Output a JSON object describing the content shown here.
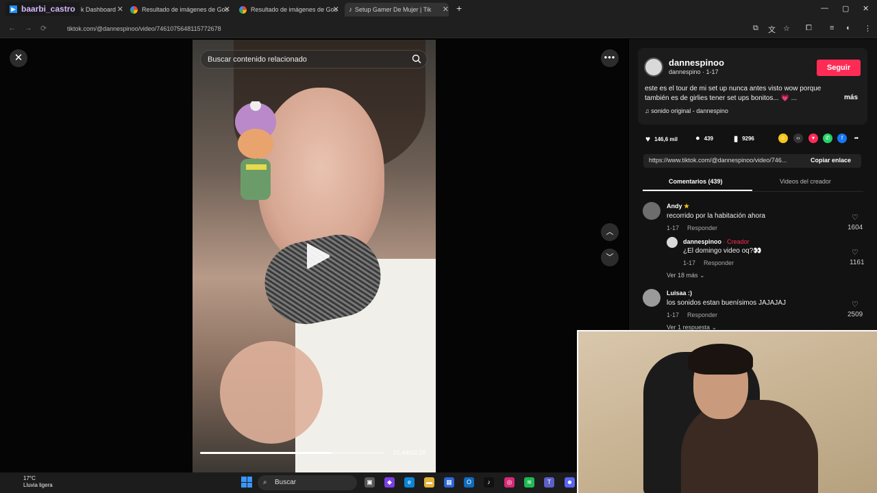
{
  "browser": {
    "streamer_tab": "baarbi_castro",
    "tabs": [
      {
        "label": "k Dashboard"
      },
      {
        "label": "Resultado de imágenes de Goo"
      },
      {
        "label": "Resultado de imágenes de Goo"
      },
      {
        "label": "Setup Gamer De Mujer | Tik"
      }
    ],
    "url": "tiktok.com/@dannespinoo/video/7461075648115772678"
  },
  "video": {
    "search_placeholder": "Buscar contenido relacionado",
    "time": "01:44/02:26",
    "progress": 0.71
  },
  "author": {
    "username": "dannespinoo",
    "subline": "dannespino · 1-17",
    "follow_label": "Seguir",
    "description": "este es el tour de mi set up nunca antes visto wow porque también es de girlies tener set ups bonitos... 💗 ...",
    "more_label": "más",
    "sound": "sonido original - dannespino"
  },
  "stats": {
    "likes": "146,6 mil",
    "comments": "439",
    "saves": "9296"
  },
  "share": {
    "link": "https://www.tiktok.com/@dannespinoo/video/746...",
    "copy_label": "Copiar enlace"
  },
  "tabs": {
    "comments": "Comentarios (439)",
    "creator_videos": "Videos del creador"
  },
  "comments": [
    {
      "name": "Andy",
      "text": "recorrido por la habitación ahora",
      "date": "1-17",
      "reply": "Responder",
      "likes": "1604"
    },
    {
      "name": "dannespinoo",
      "creator_tag": "· Creador",
      "text": "¿El domingo video oq?👀",
      "date": "1-17",
      "reply": "Responder",
      "likes": "1161"
    },
    {
      "name": "Luisaa :)",
      "text": "los sonidos estan buenísimos JAJAJAJ",
      "date": "1-17",
      "reply": "Responder",
      "likes": "2509"
    }
  ],
  "view_more_1": "Ver 18 más",
  "view_more_2": "Ver 1 respuesta",
  "taskbar": {
    "temp": "17°C",
    "weather": "Lluvia ligera",
    "search": "Buscar"
  },
  "colors": {
    "accent": "#fe2c55",
    "creator": "#fe2c55"
  }
}
